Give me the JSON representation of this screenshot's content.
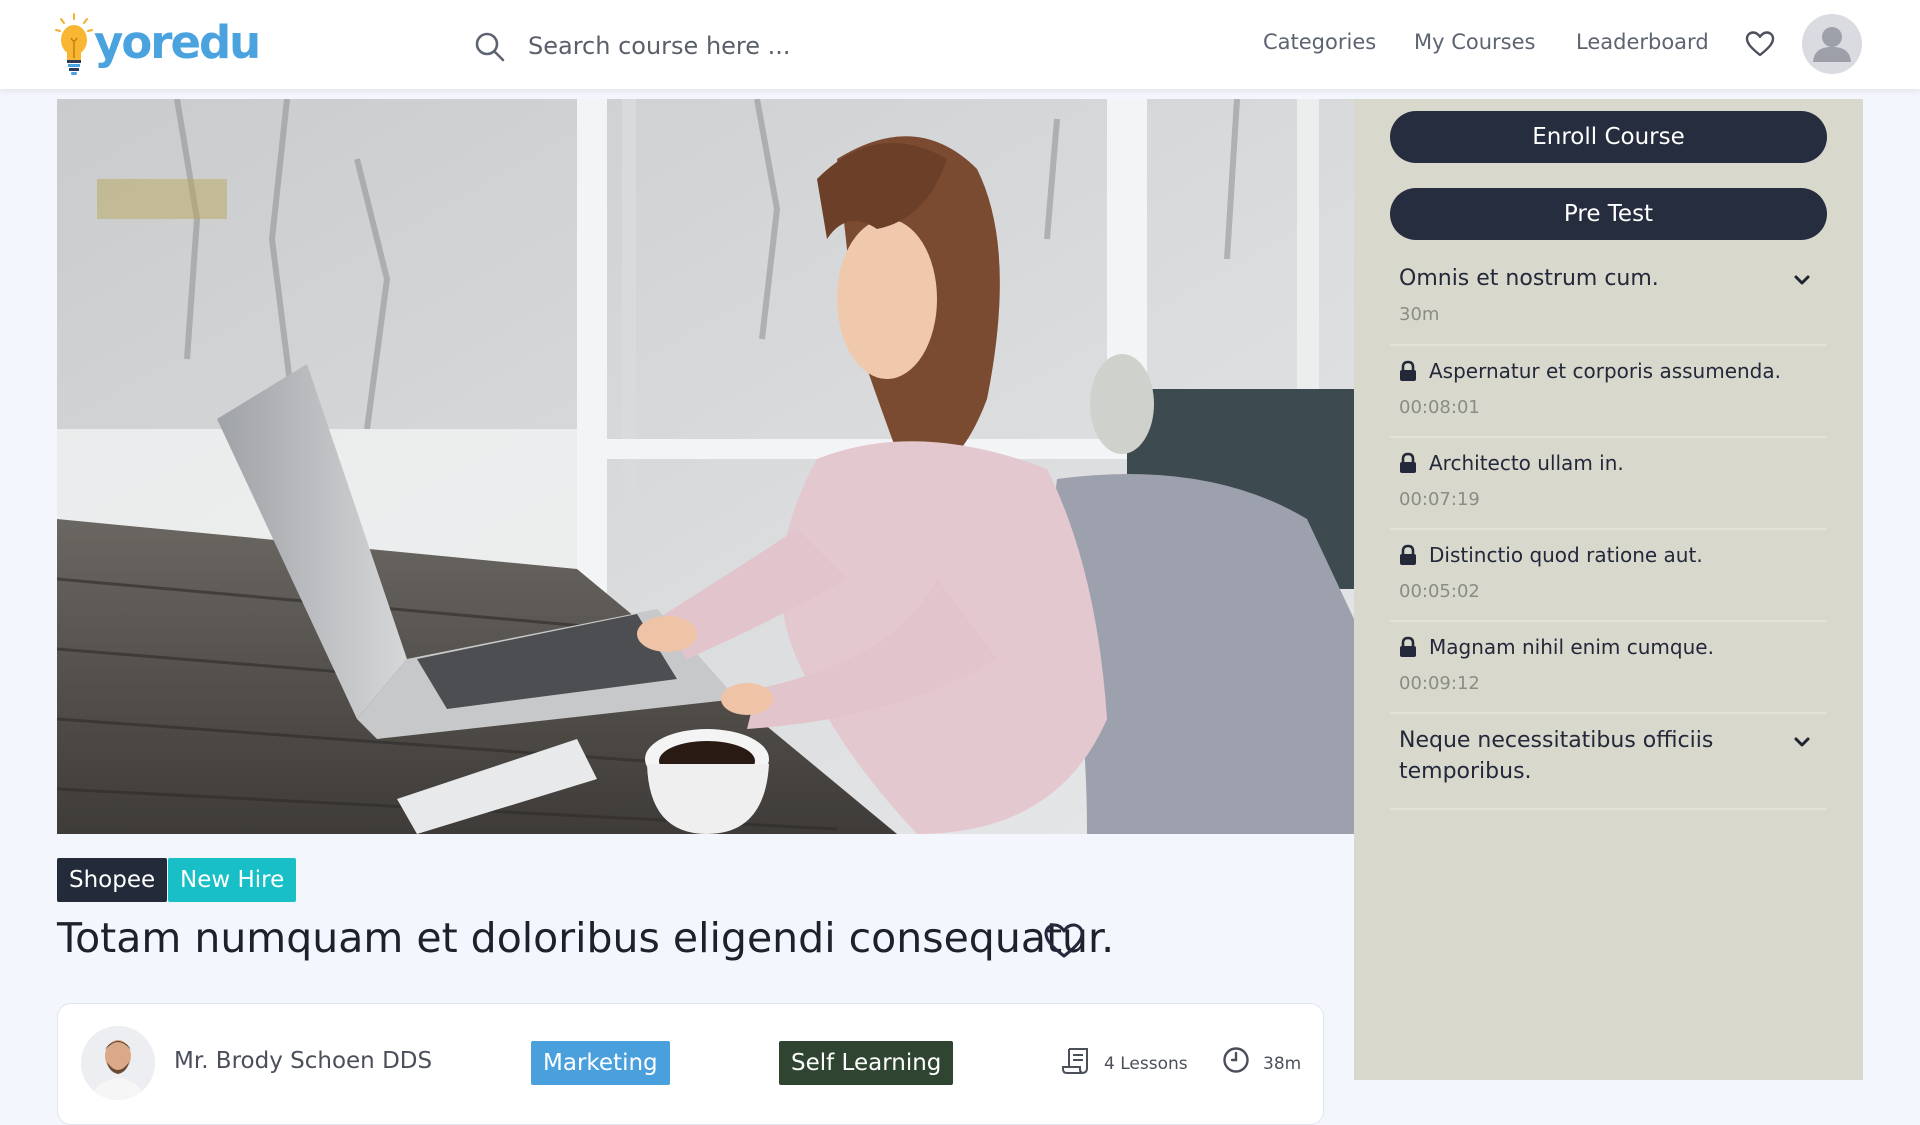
{
  "header": {
    "logo_text": "yoredu",
    "search_placeholder": "Search course here ...",
    "nav": [
      "Categories",
      "My Courses",
      "Leaderboard"
    ]
  },
  "course": {
    "tags": [
      "Shopee",
      "New Hire"
    ],
    "title": "Totam numquam et doloribus eligendi consequatur.",
    "instructor": "Mr. Brody Schoen DDS",
    "category": "Marketing",
    "type": "Self Learning",
    "lessons": "4 Lessons",
    "duration": "38m"
  },
  "sidebar": {
    "enroll_label": "Enroll Course",
    "pretest_label": "Pre Test",
    "sections": [
      {
        "title": "Omnis et nostrum cum.",
        "duration": "30m",
        "lessons": [
          {
            "title": "Aspernatur et corporis assumenda.",
            "time": "00:08:01"
          },
          {
            "title": "Architecto ullam in.",
            "time": "00:07:19"
          },
          {
            "title": "Distinctio quod ratione aut.",
            "time": "00:05:02"
          },
          {
            "title": "Magnam nihil enim cumque.",
            "time": "00:09:12"
          }
        ]
      },
      {
        "title": "Neque necessitatibus officiis temporibus."
      }
    ]
  },
  "colors": {
    "brand": "#4aa3df",
    "dark": "#262d3e",
    "teal_tag": "#18bfc7",
    "category_chip": "#4aa0dc",
    "type_chip": "#2f4531",
    "sidebar_bg": "#d8d8cc"
  },
  "icons": [
    "lightbulb-logo-icon",
    "search-icon",
    "heart-icon",
    "user-avatar-icon",
    "lock-icon",
    "chevron-down-icon",
    "lessons-icon",
    "clock-icon"
  ]
}
